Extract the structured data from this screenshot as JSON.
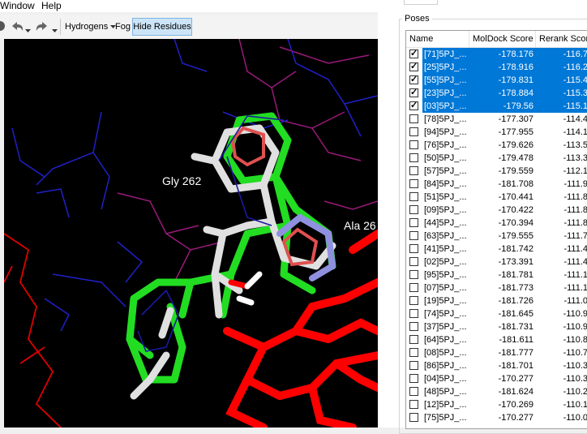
{
  "menu": {
    "window": "Window",
    "help": "Help"
  },
  "toolbar": {
    "hydrogens": "Hydrogens",
    "fog": "Fog",
    "hide_residues": "Hide Residues"
  },
  "viewport": {
    "label_gly": "Gly 262",
    "label_ala": "Ala 26"
  },
  "poses": {
    "title": "Poses",
    "columns": [
      "Name",
      "MolDock Score",
      "Rerank Score"
    ],
    "rows": [
      {
        "name": "[71]5PJ_...",
        "score": "-178.176",
        "rerank": "-116.7",
        "checked": true,
        "selected": true
      },
      {
        "name": "[25]5PJ_...",
        "score": "-178.916",
        "rerank": "-116.2",
        "checked": true,
        "selected": true
      },
      {
        "name": "[55]5PJ_...",
        "score": "-179.831",
        "rerank": "-115.4",
        "checked": true,
        "selected": true
      },
      {
        "name": "[23]5PJ_...",
        "score": "-178.884",
        "rerank": "-115.3",
        "checked": true,
        "selected": true
      },
      {
        "name": "[03]5PJ_...",
        "score": "-179.56",
        "rerank": "-115.1",
        "checked": true,
        "selected": true
      },
      {
        "name": "[78]5PJ_...",
        "score": "-177.307",
        "rerank": "-114.4",
        "checked": false,
        "selected": false
      },
      {
        "name": "[94]5PJ_...",
        "score": "-177.955",
        "rerank": "-114.1",
        "checked": false,
        "selected": false
      },
      {
        "name": "[76]5PJ_...",
        "score": "-179.626",
        "rerank": "-113.5",
        "checked": false,
        "selected": false
      },
      {
        "name": "[50]5PJ_...",
        "score": "-179.478",
        "rerank": "-113.3",
        "checked": false,
        "selected": false
      },
      {
        "name": "[57]5PJ_...",
        "score": "-179.559",
        "rerank": "-112.1",
        "checked": false,
        "selected": false
      },
      {
        "name": "[84]5PJ_...",
        "score": "-181.708",
        "rerank": "-111.9",
        "checked": false,
        "selected": false
      },
      {
        "name": "[51]5PJ_...",
        "score": "-170.441",
        "rerank": "-111.8",
        "checked": false,
        "selected": false
      },
      {
        "name": "[09]5PJ_...",
        "score": "-170.422",
        "rerank": "-111.8",
        "checked": false,
        "selected": false
      },
      {
        "name": "[44]5PJ_...",
        "score": "-170.394",
        "rerank": "-111.8",
        "checked": false,
        "selected": false
      },
      {
        "name": "[63]5PJ_...",
        "score": "-179.555",
        "rerank": "-111.7",
        "checked": false,
        "selected": false
      },
      {
        "name": "[41]5PJ_...",
        "score": "-181.742",
        "rerank": "-111.4",
        "checked": false,
        "selected": false
      },
      {
        "name": "[02]5PJ_...",
        "score": "-173.391",
        "rerank": "-111.4",
        "checked": false,
        "selected": false
      },
      {
        "name": "[95]5PJ_...",
        "score": "-181.781",
        "rerank": "-111.1",
        "checked": false,
        "selected": false
      },
      {
        "name": "[07]5PJ_...",
        "score": "-181.773",
        "rerank": "-111.1",
        "checked": false,
        "selected": false
      },
      {
        "name": "[19]5PJ_...",
        "score": "-181.726",
        "rerank": "-111.0",
        "checked": false,
        "selected": false
      },
      {
        "name": "[74]5PJ_...",
        "score": "-181.645",
        "rerank": "-110.9",
        "checked": false,
        "selected": false
      },
      {
        "name": "[37]5PJ_...",
        "score": "-181.731",
        "rerank": "-110.9",
        "checked": false,
        "selected": false
      },
      {
        "name": "[64]5PJ_...",
        "score": "-181.611",
        "rerank": "-110.8",
        "checked": false,
        "selected": false
      },
      {
        "name": "[08]5PJ_...",
        "score": "-181.777",
        "rerank": "-110.7",
        "checked": false,
        "selected": false
      },
      {
        "name": "[86]5PJ_...",
        "score": "-181.701",
        "rerank": "-110.3",
        "checked": false,
        "selected": false
      },
      {
        "name": "[04]5PJ_...",
        "score": "-170.277",
        "rerank": "-110.3",
        "checked": false,
        "selected": false
      },
      {
        "name": "[48]5PJ_...",
        "score": "-181.624",
        "rerank": "-110.2",
        "checked": false,
        "selected": false
      },
      {
        "name": "[12]5PJ_...",
        "score": "-170.269",
        "rerank": "-110.1",
        "checked": false,
        "selected": false
      },
      {
        "name": "[75]5PJ_...",
        "score": "-170.277",
        "rerank": "-110.0",
        "checked": false,
        "selected": false
      }
    ]
  }
}
